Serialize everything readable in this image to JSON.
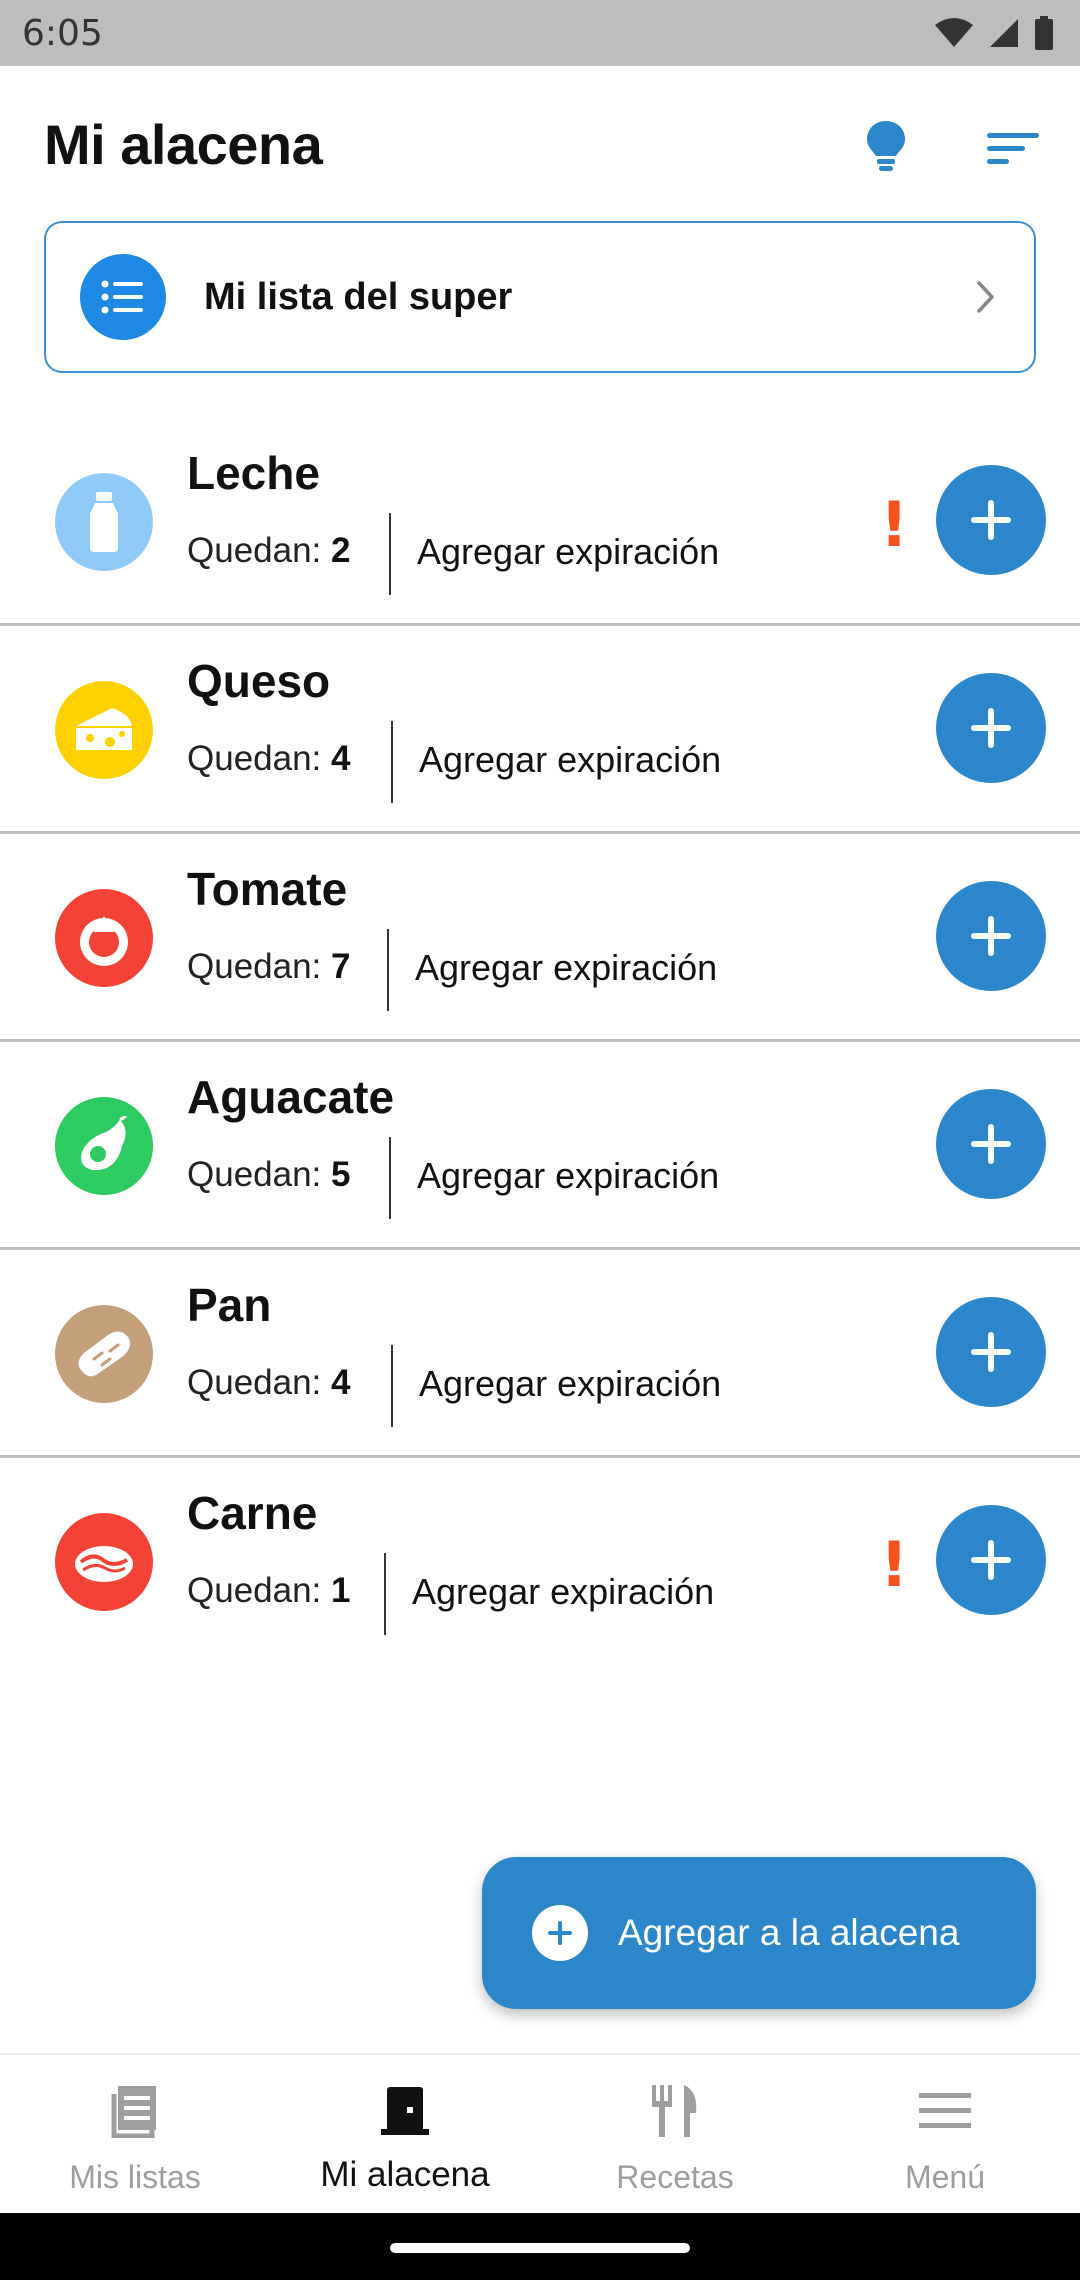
{
  "status_bar": {
    "time": "6:05",
    "icons": [
      "wifi-icon",
      "signal-icon",
      "battery-icon"
    ]
  },
  "header": {
    "title": "Mi alacena",
    "actions": [
      "lightbulb-icon",
      "sort-icon"
    ]
  },
  "shopping_list": {
    "label": "Mi lista del super",
    "icon": "list-icon"
  },
  "items": [
    {
      "name": "Leche",
      "qty_label": "Quedan:",
      "qty": "2",
      "exp_label": "Agregar expiración",
      "icon": "milk-bottle-icon",
      "color": "#90caf9",
      "warning": "!"
    },
    {
      "name": "Queso",
      "qty_label": "Quedan:",
      "qty": "4",
      "exp_label": "Agregar expiración",
      "icon": "cheese-icon",
      "color": "#fdd100",
      "warning": ""
    },
    {
      "name": "Tomate",
      "qty_label": "Quedan:",
      "qty": "7",
      "exp_label": "Agregar expiración",
      "icon": "tomato-icon",
      "color": "#f44336",
      "warning": ""
    },
    {
      "name": "Aguacate",
      "qty_label": "Quedan:",
      "qty": "5",
      "exp_label": "Agregar expiración",
      "icon": "avocado-icon",
      "color": "#2ecc60",
      "warning": ""
    },
    {
      "name": "Pan",
      "qty_label": "Quedan:",
      "qty": "4",
      "exp_label": "Agregar expiración",
      "icon": "bread-icon",
      "color": "#c4a07a",
      "warning": ""
    },
    {
      "name": "Carne",
      "qty_label": "Quedan:",
      "qty": "1",
      "exp_label": "Agregar expiración",
      "icon": "steak-icon",
      "color": "#f44336",
      "warning": "!"
    }
  ],
  "fab": {
    "label": "Agregar a la alacena",
    "icon": "plus-circle-icon"
  },
  "bottom_nav": [
    {
      "label": "Mis listas",
      "icon": "list-document-icon",
      "active": false
    },
    {
      "label": "Mi alacena",
      "icon": "pantry-icon",
      "active": true
    },
    {
      "label": "Recetas",
      "icon": "fork-knife-icon",
      "active": false
    },
    {
      "label": "Menú",
      "icon": "hamburger-menu-icon",
      "active": false
    }
  ],
  "colors": {
    "accent": "#2b87c9",
    "warning": "#f4511e",
    "status_bar": "#bdbdbd"
  }
}
